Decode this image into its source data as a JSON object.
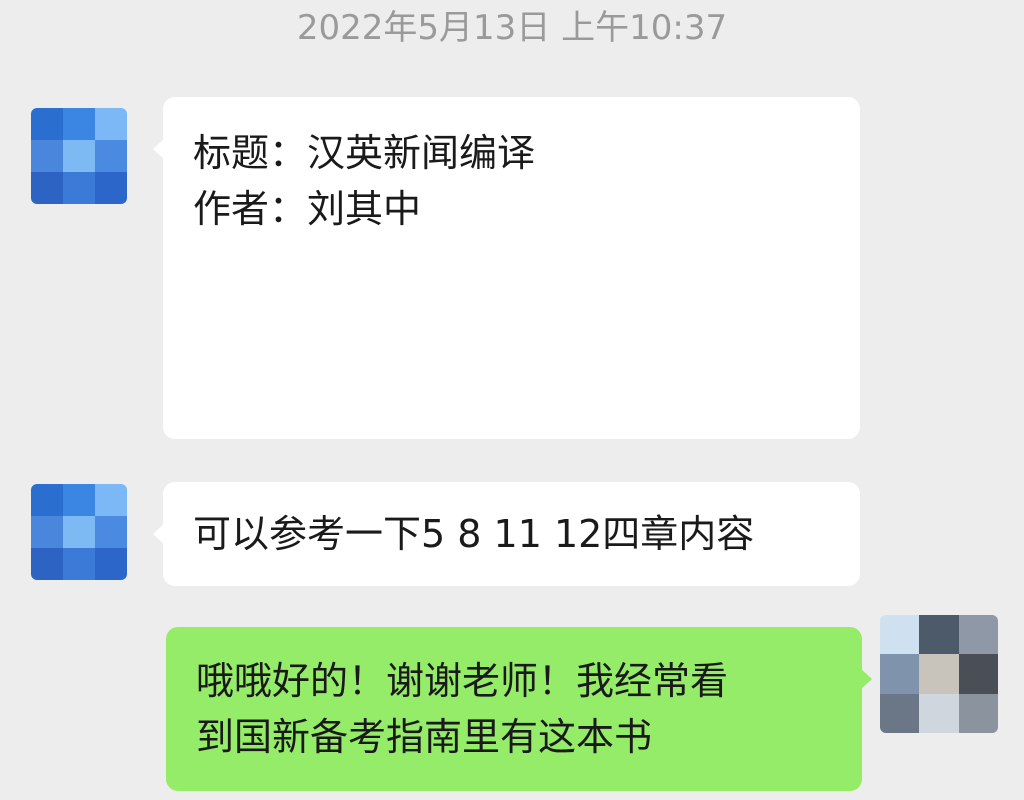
{
  "timestamp": "2022年5月13日 上午10:37",
  "messages": [
    {
      "direction": "incoming",
      "lines": [
        "标题：汉英新闻编译",
        "作者：刘其中"
      ]
    },
    {
      "direction": "incoming",
      "lines": [
        "可以参考一下5 8 11 12四章内容"
      ]
    },
    {
      "direction": "outgoing",
      "lines": [
        "哦哦好的！谢谢老师！我经常看",
        "到国新备考指南里有这本书"
      ]
    }
  ],
  "colors": {
    "background": "#ededed",
    "incoming_bubble": "#ffffff",
    "outgoing_bubble": "#95ec69",
    "timestamp_text": "#9a9a9a"
  },
  "avatar_pixels": {
    "teacher": [
      "#2a6fd0",
      "#3b86e3",
      "#7cb8f5",
      "#4a86dc",
      "#7db9f2",
      "#4a8ae0",
      "#2d64c4",
      "#3b7ad6",
      "#2b66c8"
    ],
    "self": [
      "#cfe0f0",
      "#4d5a6a",
      "#8e98a6",
      "#7f93ad",
      "#c8c3bb",
      "#4a4f57",
      "#6b7786",
      "#cfd6de",
      "#8b939e"
    ]
  }
}
